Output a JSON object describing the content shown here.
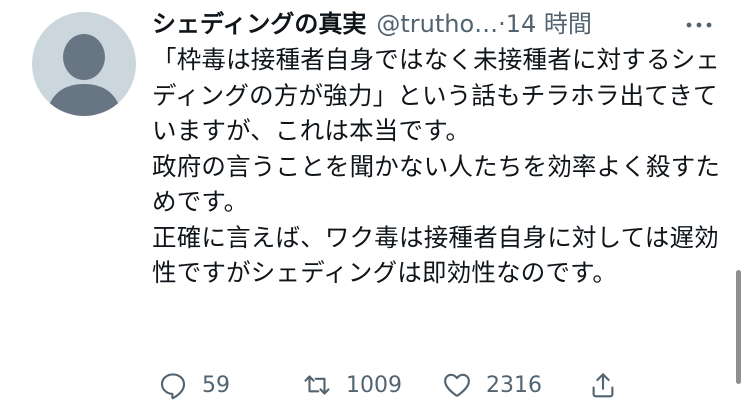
{
  "author": {
    "name": "シェディングの真実",
    "handle": "@trutho…",
    "separator": "·",
    "time": "14 時間"
  },
  "tweet": {
    "paragraphs": [
      "「枠毒は接種者自身ではなく未接種者に対するシェディングの方が強力」という話もチラホラ出てきていますが、これは本当です。",
      "政府の言うことを聞かない人たちを効率よく殺すためです。",
      "正確に言えば、ワク毒は接種者自身に対しては遅効性ですがシェディングは即効性なのです。"
    ]
  },
  "actions": {
    "reply_count": "59",
    "retweet_count": "1009",
    "like_count": "2316"
  },
  "icons": {
    "avatar": "default-avatar-icon",
    "more": "more-dots-icon",
    "reply": "reply-icon",
    "retweet": "retweet-icon",
    "like": "heart-icon",
    "share": "share-icon"
  },
  "colors": {
    "text": "#0f1419",
    "secondary": "#536471",
    "avatar_bg": "#ccd6dd",
    "avatar_fg": "#687684"
  }
}
